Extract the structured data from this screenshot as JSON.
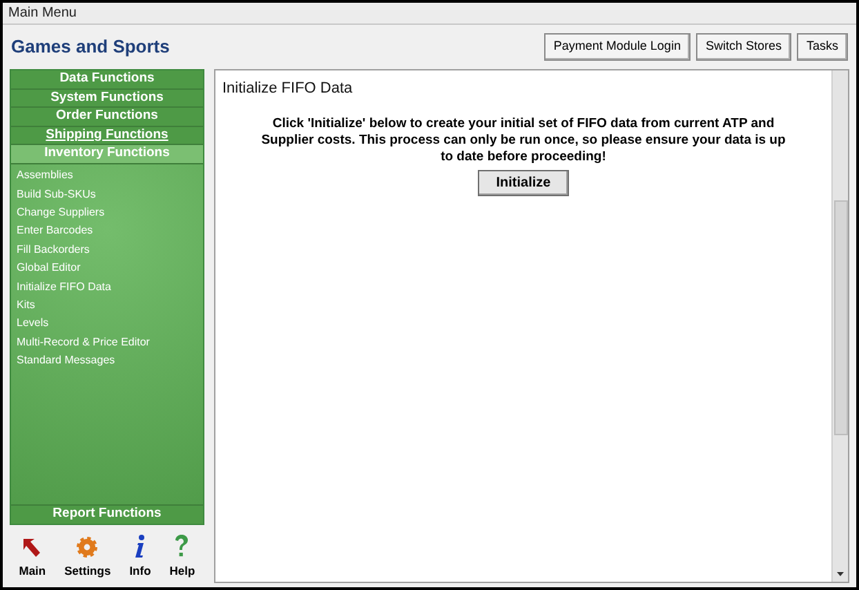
{
  "window": {
    "title": "Main Menu"
  },
  "header": {
    "title": "Games and Sports",
    "buttons": [
      "Payment Module Login",
      "Switch Stores",
      "Tasks"
    ]
  },
  "sidebar": {
    "sections": [
      {
        "label": "Data Functions",
        "selected": false,
        "hovered": false
      },
      {
        "label": "System Functions",
        "selected": false,
        "hovered": false
      },
      {
        "label": "Order Functions",
        "selected": false,
        "hovered": false
      },
      {
        "label": "Shipping Functions",
        "selected": false,
        "hovered": true
      },
      {
        "label": "Inventory Functions",
        "selected": true,
        "hovered": false
      }
    ],
    "items": [
      "Assemblies",
      "Build Sub-SKUs",
      "Change Suppliers",
      "Enter Barcodes",
      "Fill Backorders",
      "Global Editor",
      "Initialize FIFO Data",
      "Kits",
      "Levels",
      "Multi-Record & Price Editor",
      "Standard Messages"
    ],
    "bottom_section": {
      "label": "Report Functions"
    },
    "tools": [
      {
        "kind": "main",
        "label": "Main"
      },
      {
        "kind": "settings",
        "label": "Settings"
      },
      {
        "kind": "info",
        "label": "Info"
      },
      {
        "kind": "help",
        "label": "Help"
      }
    ]
  },
  "content": {
    "title": "Initialize FIFO Data",
    "message": "Click 'Initialize' below to create your initial set of FIFO data from current ATP and Supplier costs. This process can only be run once, so please ensure your data is up to date before proceeding!",
    "button": "Initialize"
  }
}
